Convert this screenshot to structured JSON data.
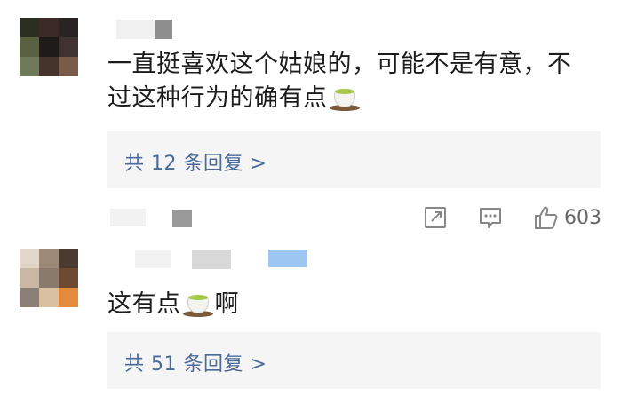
{
  "comments": [
    {
      "avatar_colors": [
        "#2a2f22",
        "#3b2a26",
        "#2a2323",
        "#5a6143",
        "#1e1b18",
        "#403230",
        "#6f7a5a",
        "#45342c",
        "#7a5a48"
      ],
      "name_blur": "#8e8e8e",
      "text_line1": "一直挺喜欢这个姑娘的，可能不是有意，不",
      "text_line2_before": "过这种行为的确有点",
      "emoji": "tea-emoji",
      "text_line2_after": "",
      "reply_link": "共 12 条回复 >"
    },
    {
      "avatar_colors": [
        "#e2d6c8",
        "#9b8a78",
        "#4a3a30",
        "#c9b7a4",
        "#8a7a6c",
        "#6e4a32",
        "#8c7f78",
        "#d8c0a0",
        "#e48a3a"
      ],
      "name_blurs": [
        "#e4e4e4",
        "#d0d0d0",
        "#9ec6f2"
      ],
      "text_before": "这有点",
      "emoji": "tea-emoji",
      "text_after": "啊",
      "reply_link": "共 51 条回复 >"
    }
  ],
  "actions": {
    "share_icon": "share-icon",
    "comment_icon": "comment-icon",
    "like_icon": "thumbs-up-icon",
    "like_count": "603"
  },
  "colors": {
    "link": "#4a6a99",
    "reply_bg": "#f5f5f5",
    "icon": "#888888"
  }
}
